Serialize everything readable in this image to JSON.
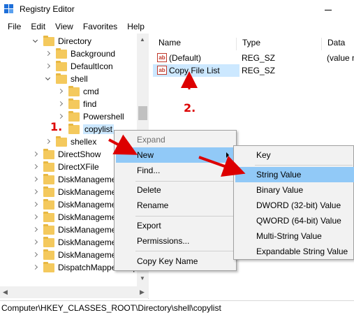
{
  "window": {
    "title": "Registry Editor"
  },
  "menubar": {
    "items": [
      "File",
      "Edit",
      "View",
      "Favorites",
      "Help"
    ]
  },
  "tree": {
    "items": [
      {
        "label": "Directory",
        "expanded": true
      },
      {
        "label": "Background",
        "expanded": false
      },
      {
        "label": "DefaultIcon",
        "expanded": false
      },
      {
        "label": "shell",
        "expanded": true
      },
      {
        "label": "cmd",
        "expanded": false
      },
      {
        "label": "find",
        "expanded": false
      },
      {
        "label": "Powershell",
        "expanded": false
      },
      {
        "label": "copylist",
        "selected": true
      },
      {
        "label": "shellex",
        "expanded": false
      },
      {
        "label": "DirectShow",
        "expanded": false
      },
      {
        "label": "DirectXFile",
        "expanded": false
      },
      {
        "label": "DiskManageme",
        "expanded": false
      },
      {
        "label": "DiskManageme",
        "expanded": false
      },
      {
        "label": "DiskManageme",
        "expanded": false
      },
      {
        "label": "DiskManageme",
        "expanded": false
      },
      {
        "label": "DiskManageme",
        "expanded": false
      },
      {
        "label": "DiskManageme",
        "expanded": false
      },
      {
        "label": "DiskManageme",
        "expanded": false
      },
      {
        "label": "DispatchMapper.Disp",
        "expanded": false
      }
    ]
  },
  "list": {
    "columns": [
      "Name",
      "Type",
      "Data"
    ],
    "rows": [
      {
        "icon": "ab",
        "name": "(Default)",
        "type": "REG_SZ",
        "data": "(value n"
      },
      {
        "icon": "ab",
        "name": "Copy File List",
        "type": "REG_SZ",
        "data": "",
        "selected": true
      }
    ]
  },
  "context_menu": {
    "items": [
      "Expand",
      "New",
      "Find...",
      "Delete",
      "Rename",
      "Export",
      "Permissions...",
      "Copy Key Name"
    ],
    "highlighted": "New"
  },
  "submenu": {
    "items": [
      "Key",
      "String Value",
      "Binary Value",
      "DWORD (32-bit) Value",
      "QWORD (64-bit) Value",
      "Multi-String Value",
      "Expandable String Value"
    ],
    "highlighted": "String Value"
  },
  "annotations": {
    "step1": "1.",
    "step2": "2."
  },
  "statusbar": {
    "path": "Computer\\HKEY_CLASSES_ROOT\\Directory\\shell\\copylist"
  },
  "colors": {
    "selection": "#cce8ff",
    "menu_highlight": "#91c9f7",
    "annotation": "#dd0000"
  }
}
